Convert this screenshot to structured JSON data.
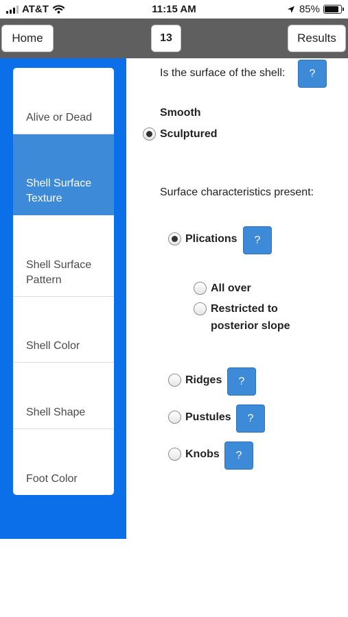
{
  "status_bar": {
    "carrier": "AT&T",
    "time": "11:15 AM",
    "battery": "85%",
    "battery_level": 0.85,
    "icons": [
      "signal-icon",
      "wifi-icon",
      "location-arrow-icon",
      "battery-icon"
    ]
  },
  "nav": {
    "home_label": "Home",
    "page_number": "13",
    "results_label": "Results"
  },
  "sidebar": {
    "items": [
      {
        "label": "Alive or Dead",
        "active": false
      },
      {
        "label": "Shell Surface Texture",
        "active": true
      },
      {
        "label": "Shell Surface Pattern",
        "active": false
      },
      {
        "label": "Shell Color",
        "active": false
      },
      {
        "label": "Shell Shape",
        "active": false
      },
      {
        "label": "Foot Color",
        "active": false
      }
    ]
  },
  "main": {
    "question": "Is the surface of the shell:",
    "help_label": "?",
    "options": [
      {
        "label": "Smooth",
        "has_radio": false,
        "checked": false
      },
      {
        "label": "Sculptured",
        "has_radio": true,
        "checked": true
      }
    ],
    "characteristics_heading": "Surface characteristics present:",
    "characteristics": [
      {
        "label": "Plications",
        "checked": true,
        "help": "?"
      },
      {
        "label": "Ridges",
        "checked": false,
        "help": "?"
      },
      {
        "label": "Pustules",
        "checked": false,
        "help": "?"
      },
      {
        "label": "Knobs",
        "checked": false,
        "help": "?"
      }
    ],
    "plication_sub_options": [
      {
        "label": "All over",
        "checked": false
      },
      {
        "label": "Restricted to posterior slope",
        "checked": false
      }
    ]
  },
  "colors": {
    "sidebar_bg": "#0b6fe9",
    "active_item": "#3d8ad9",
    "help_button": "#3d8ad9",
    "topbar_bg": "#5f5f5f"
  }
}
